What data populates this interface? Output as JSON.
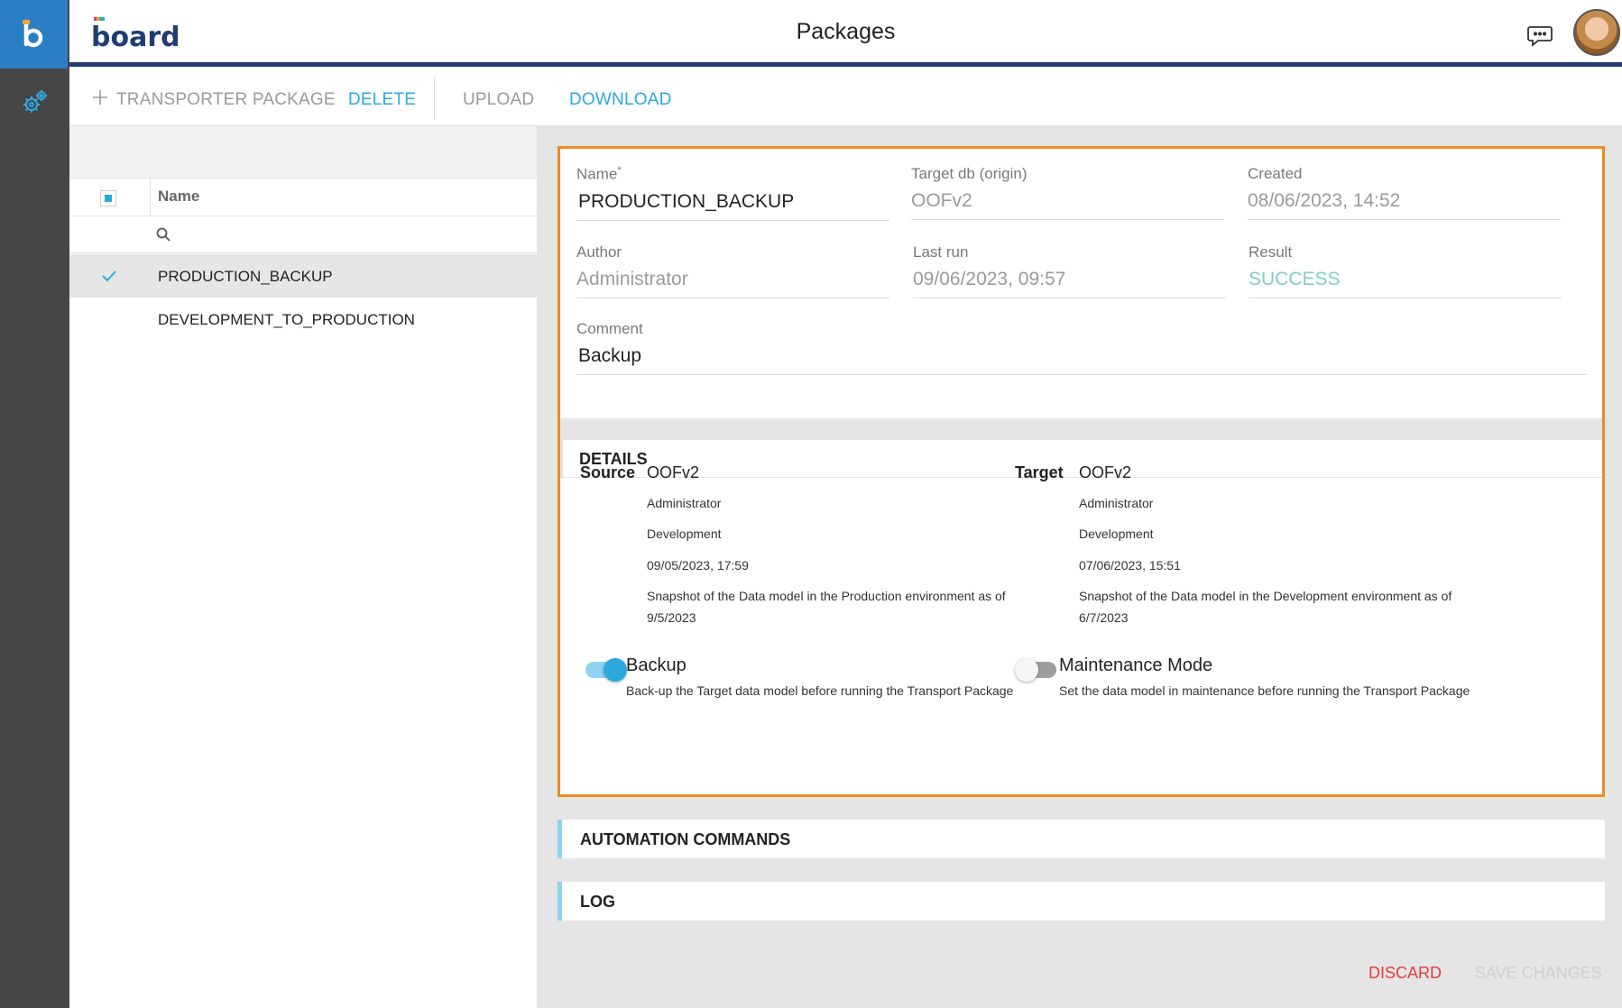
{
  "app": {
    "title": "Packages",
    "brand": "board"
  },
  "toolbar": {
    "transporter_label": "TRANSPORTER PACKAGE",
    "delete_label": "DELETE",
    "upload_label": "UPLOAD",
    "download_label": "DOWNLOAD"
  },
  "list": {
    "column_name": "Name",
    "search_placeholder": "",
    "rows": [
      {
        "name": "PRODUCTION_BACKUP",
        "selected": true
      },
      {
        "name": "DEVELOPMENT_TO_PRODUCTION",
        "selected": false
      }
    ]
  },
  "package": {
    "name_label": "Name",
    "name_required": "*",
    "name": "PRODUCTION_BACKUP",
    "target_label": "Target db (origin)",
    "target": "OOFv2",
    "created_label": "Created",
    "created": "08/06/2023, 14:52",
    "author_label": "Author",
    "author": "Administrator",
    "lastrun_label": "Last run",
    "lastrun": "09/06/2023, 09:57",
    "result_label": "Result",
    "result": "SUCCESS",
    "comment_label": "Comment",
    "comment": "Backup"
  },
  "details": {
    "title": "DETAILS",
    "source": {
      "label": "Source",
      "db": "OOFv2",
      "user": "Administrator",
      "environment": "Development",
      "timestamp": "09/05/2023, 17:59",
      "description_line1": "Snapshot of the Data model in the Production environment as of",
      "description_line2": "9/5/2023"
    },
    "target": {
      "label": "Target",
      "db": "OOFv2",
      "user": "Administrator",
      "environment": "Development",
      "timestamp": "07/06/2023, 15:51",
      "description_line1": "Snapshot of the Data model in the Development environment as of",
      "description_line2": "6/7/2023"
    },
    "backup": {
      "label": "Backup",
      "description": "Back-up the Target data model before running the Transport Package",
      "enabled": true
    },
    "maintenance": {
      "label": "Maintenance Mode",
      "description": "Set the data model in maintenance before running the Transport Package",
      "enabled": false
    }
  },
  "sections": {
    "automation": "AUTOMATION COMMANDS",
    "log": "LOG"
  },
  "footer": {
    "discard": "DISCARD",
    "save": "SAVE CHANGES"
  },
  "colors": {
    "accent": "#2ba9df",
    "highlight_border": "#f08a24",
    "success": "#7ed0c3",
    "discard": "#e53b3b",
    "header_rule": "#233b70",
    "rail": "#464646",
    "rail_logo": "#2a7fc4"
  },
  "icons": [
    "board-logo-icon",
    "settings-gears-icon",
    "chat-icon",
    "plus-icon",
    "search-icon",
    "check-icon"
  ]
}
